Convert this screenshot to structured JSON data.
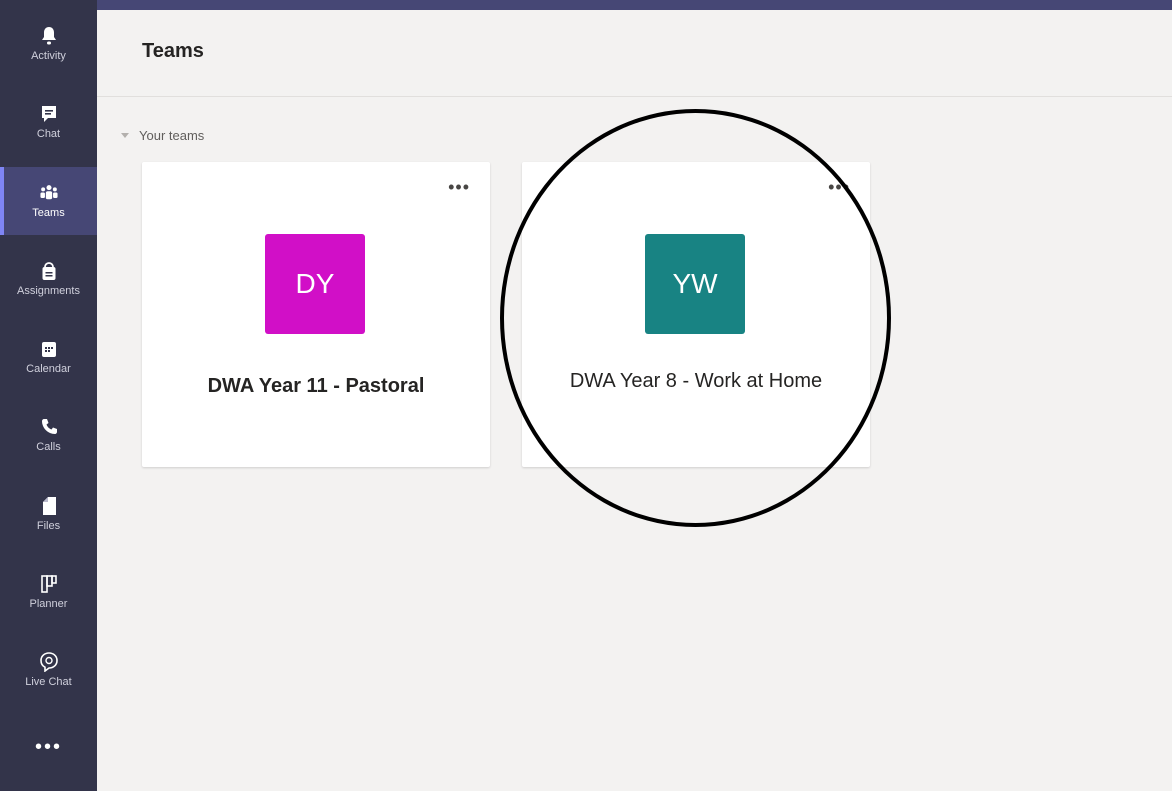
{
  "rail": {
    "items": [
      {
        "label": "Activity",
        "icon": "bell-icon"
      },
      {
        "label": "Chat",
        "icon": "chat-icon"
      },
      {
        "label": "Teams",
        "icon": "teams-icon"
      },
      {
        "label": "Assignments",
        "icon": "assignments-icon"
      },
      {
        "label": "Calendar",
        "icon": "calendar-icon"
      },
      {
        "label": "Calls",
        "icon": "phone-icon"
      },
      {
        "label": "Files",
        "icon": "file-icon"
      },
      {
        "label": "Planner",
        "icon": "planner-icon"
      },
      {
        "label": "Live Chat",
        "icon": "live-chat-icon"
      }
    ],
    "active": "Teams",
    "more_label": "•••"
  },
  "header": {
    "title": "Teams"
  },
  "section": {
    "label": "Your teams"
  },
  "teams": [
    {
      "initials": "DY",
      "name": "DWA Year 11 - Pastoral",
      "color": "#d10fc7",
      "more": "•••"
    },
    {
      "initials": "YW",
      "name": "DWA Year 8 - Work at Home",
      "color": "#188383",
      "more": "•••"
    }
  ],
  "colors": {
    "rail": "#33344a",
    "rail_active": "#464775",
    "background": "#f3f2f1"
  }
}
